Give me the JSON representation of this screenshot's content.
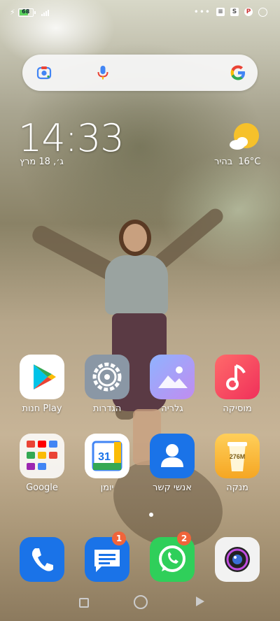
{
  "status_bar": {
    "battery_level": "68",
    "battery_fraction": 0.68
  },
  "search": {
    "colors": {
      "g_blue": "#4285F4",
      "g_red": "#EA4335",
      "g_yellow": "#FBBC05",
      "g_green": "#34A853"
    }
  },
  "clock": {
    "time": "14:33",
    "date": "ג׳, 18 מרץ"
  },
  "weather": {
    "temperature": "16°C",
    "condition": "בהיר",
    "icon": "partly-sunny-icon"
  },
  "apps": [
    {
      "label": "חנות Play",
      "icon": "play-store-icon"
    },
    {
      "label": "הגדרות",
      "icon": "settings-gear-icon"
    },
    {
      "label": "גלריה",
      "icon": "gallery-icon"
    },
    {
      "label": "מוסיקה",
      "icon": "music-note-icon"
    },
    {
      "label": "Google",
      "icon": "google-folder-icon"
    },
    {
      "label": "יומן",
      "icon": "calendar-icon",
      "day": "31"
    },
    {
      "label": "אנשי קשר",
      "icon": "contacts-icon"
    },
    {
      "label": "מנקה",
      "icon": "cleaner-icon",
      "size": "276M"
    }
  ],
  "dock": [
    {
      "name": "phone",
      "icon": "phone-icon"
    },
    {
      "name": "messages",
      "icon": "messages-icon",
      "badge": "1"
    },
    {
      "name": "whatsapp",
      "icon": "whatsapp-icon",
      "badge": "2"
    },
    {
      "name": "camera",
      "icon": "camera-icon"
    }
  ]
}
